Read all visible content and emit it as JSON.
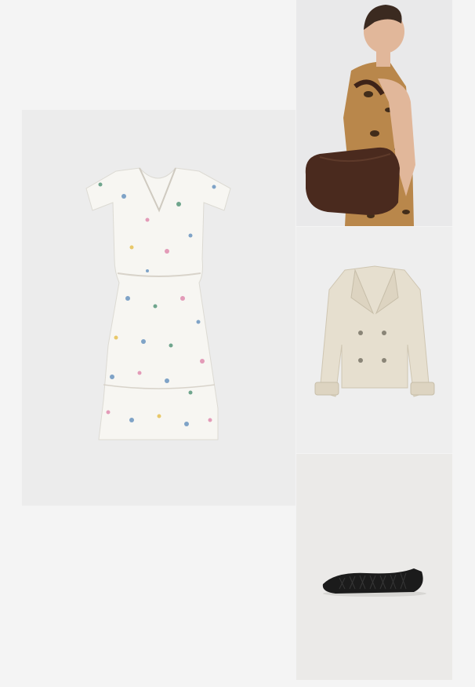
{
  "outfit": {
    "items": [
      {
        "id": "dress",
        "alt": "",
        "background": "#ececec"
      },
      {
        "id": "bag",
        "alt": "",
        "background": "#e9e9ea"
      },
      {
        "id": "coat",
        "alt": "",
        "background": "#eeeeee"
      },
      {
        "id": "shoe",
        "alt": "",
        "background": "#ebeae8"
      }
    ]
  },
  "colors": {
    "page_background": "#f4f4f4",
    "dress_base": "#f7f6f2",
    "bag_leather": "#4a2a1e",
    "coat_fabric": "#e6dfcf",
    "shoe_black": "#1b1b1b"
  }
}
